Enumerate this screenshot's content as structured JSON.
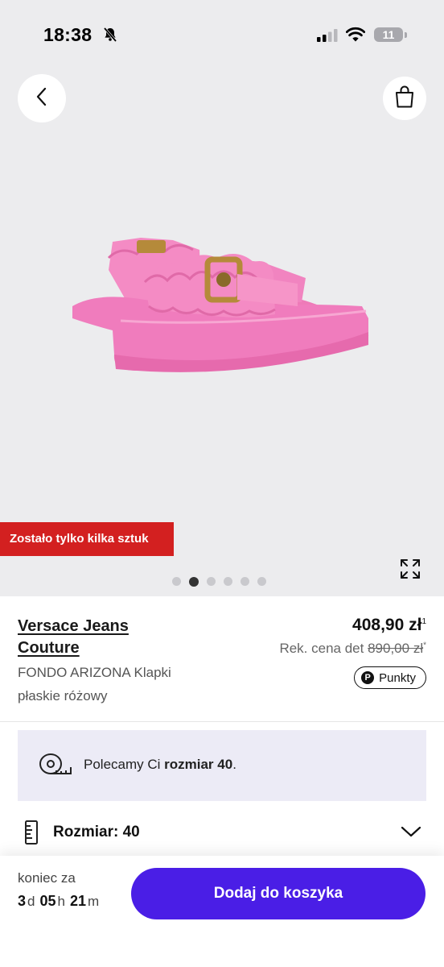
{
  "status_bar": {
    "time": "18:38",
    "battery": "11",
    "icons": [
      "bell-slash-icon",
      "signal-icon",
      "wifi-icon",
      "battery-icon"
    ]
  },
  "hero": {
    "badge": "Zostało tylko kilka sztuk",
    "image_colors": {
      "background": "#ececee",
      "sandal": "#f07cbd"
    },
    "gallery_total": 6,
    "gallery_active": 2
  },
  "product": {
    "brand": "Versace Jeans Couture",
    "brand_line1": "Versace Jeans",
    "brand_line2": "Couture",
    "model": "FONDO ARIZONA Klapki płaskie różowy",
    "price": "408,90 zł",
    "price_note": "1",
    "rrp_label": "Rek. cena det",
    "rrp_value": "890,00 zł",
    "rrp_note": "*",
    "points_label": "Punkty"
  },
  "recommendation": {
    "prefix": "Polecamy Ci ",
    "size": "rozmiar 40",
    "suffix": "."
  },
  "size_selector": {
    "label": "Rozmiar: 40"
  },
  "footer": {
    "ends_label": "koniec za",
    "days": "3",
    "days_unit": "d",
    "hours": "05",
    "hours_unit": "h",
    "minutes": "21",
    "minutes_unit": "m",
    "cta": "Dodaj do koszyka"
  },
  "colors": {
    "accent": "#4a1ee6",
    "badge": "#d32020",
    "recommendation_bg": "#ecebf6"
  }
}
